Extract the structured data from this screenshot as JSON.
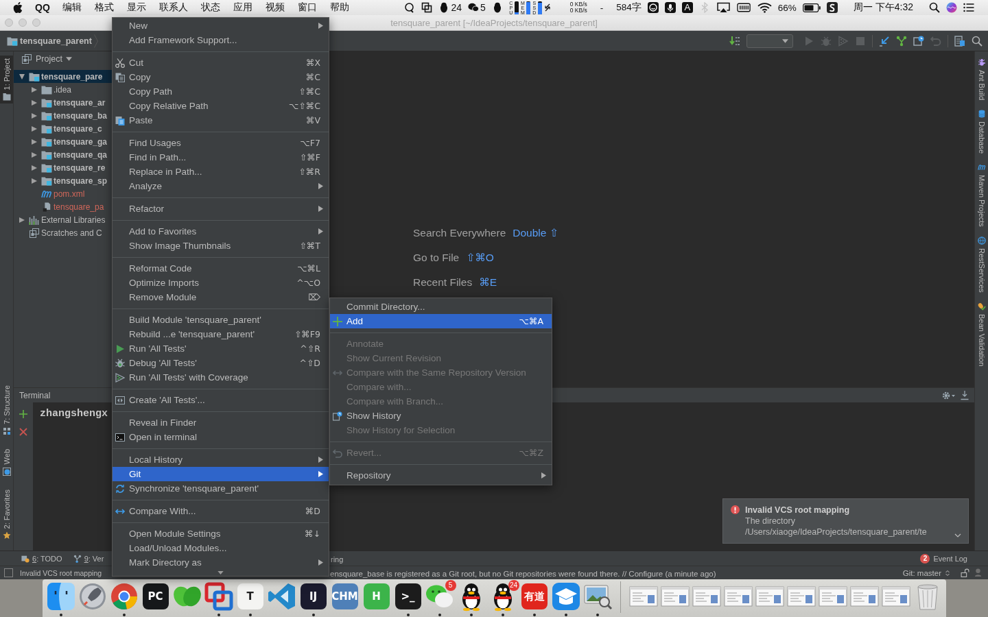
{
  "menubar": {
    "app": "QQ",
    "menus": [
      "编辑",
      "格式",
      "显示",
      "联系人",
      "状态",
      "应用",
      "视频",
      "窗口",
      "帮助"
    ],
    "qq_count": "24",
    "wechat_count": "5",
    "meters": [
      {
        "label": "CPU",
        "level": 0.15
      },
      {
        "label": "MEM",
        "level": 0.9
      },
      {
        "label": "SSD",
        "level": 0.85
      }
    ],
    "net": [
      "0 KB/s",
      "0 KB/s"
    ],
    "dash": "-",
    "word_count": "584字",
    "input_mode": "A",
    "battery": "66%",
    "clock": "周一 下午4:32"
  },
  "window": {
    "title": "tensquare_parent [~/IdeaProjects/tensquare_parent]"
  },
  "navbar": {
    "breadcrumb": "tensquare_parent"
  },
  "left_strip": {
    "top": [
      {
        "label": "1: Project",
        "selected": true
      }
    ],
    "bottom": [
      {
        "label": "7: Structure",
        "selected": false
      },
      {
        "label": "Web",
        "selected": false
      },
      {
        "label": "2: Favorites",
        "selected": false
      }
    ]
  },
  "right_strip": [
    "Ant Build",
    "Database",
    "Maven Projects",
    "RestServices",
    "Bean Validation"
  ],
  "project": {
    "title": "Project",
    "tree": [
      {
        "label": "tensquare_pare",
        "kind": "module",
        "expanded": true,
        "selected": true,
        "unversioned": false,
        "children": [
          {
            "label": ".idea",
            "kind": "folder",
            "expanded": false,
            "selected": false,
            "unversioned": false
          },
          {
            "label": "tensquare_ar",
            "kind": "module",
            "expanded": false,
            "selected": false,
            "unversioned": false
          },
          {
            "label": "tensquare_ba",
            "kind": "module",
            "expanded": false,
            "selected": false,
            "unversioned": false
          },
          {
            "label": "tensquare_c",
            "kind": "module",
            "expanded": false,
            "selected": false,
            "unversioned": false
          },
          {
            "label": "tensquare_ga",
            "kind": "module",
            "expanded": false,
            "selected": false,
            "unversioned": false
          },
          {
            "label": "tensquare_qa",
            "kind": "module",
            "expanded": false,
            "selected": false,
            "unversioned": false
          },
          {
            "label": "tensquare_re",
            "kind": "module",
            "expanded": false,
            "selected": false,
            "unversioned": false
          },
          {
            "label": "tensquare_sp",
            "kind": "module",
            "expanded": false,
            "selected": false,
            "unversioned": false
          },
          {
            "label": "pom.xml",
            "kind": "maven",
            "selected": false,
            "unversioned": true
          },
          {
            "label": "tensquare_pa",
            "kind": "file",
            "selected": false,
            "unversioned": true
          }
        ]
      },
      {
        "label": "External Libraries",
        "kind": "libraries",
        "expanded": false,
        "selected": false,
        "unversioned": false
      },
      {
        "label": "Scratches and C",
        "kind": "scratches",
        "selected": false,
        "unversioned": false
      }
    ]
  },
  "editor": {
    "hints": [
      {
        "label": "Search Everywhere",
        "shortcut": "Double ⇧"
      },
      {
        "label": "Go to File",
        "shortcut": "⇧⌘O"
      },
      {
        "label": "Recent Files",
        "shortcut": "⌘E"
      }
    ]
  },
  "terminal": {
    "title": "Terminal",
    "prompt": "zhangshengx"
  },
  "context_menu": {
    "items": [
      {
        "kind": "item",
        "label": "New",
        "submenu": true,
        "selected": false
      },
      {
        "kind": "item",
        "label": "Add Framework Support...",
        "submenu": false,
        "selected": false
      },
      {
        "kind": "separator"
      },
      {
        "kind": "item",
        "label": "Cut",
        "shortcut": "⌘X",
        "submenu": false,
        "selected": false
      },
      {
        "kind": "item",
        "label": "Copy",
        "shortcut": "⌘C",
        "submenu": false,
        "selected": false
      },
      {
        "kind": "item",
        "label": "Copy Path",
        "shortcut": "⇧⌘C",
        "submenu": false,
        "selected": false
      },
      {
        "kind": "item",
        "label": "Copy Relative Path",
        "shortcut": "⌥⇧⌘C",
        "submenu": false,
        "selected": false
      },
      {
        "kind": "item",
        "label": "Paste",
        "shortcut": "⌘V",
        "submenu": false,
        "selected": false
      },
      {
        "kind": "separator"
      },
      {
        "kind": "item",
        "label": "Find Usages",
        "shortcut": "⌥F7",
        "submenu": false,
        "selected": false
      },
      {
        "kind": "item",
        "label": "Find in Path...",
        "shortcut": "⇧⌘F",
        "submenu": false,
        "selected": false
      },
      {
        "kind": "item",
        "label": "Replace in Path...",
        "shortcut": "⇧⌘R",
        "submenu": false,
        "selected": false
      },
      {
        "kind": "item",
        "label": "Analyze",
        "submenu": true,
        "selected": false
      },
      {
        "kind": "separator"
      },
      {
        "kind": "item",
        "label": "Refactor",
        "submenu": true,
        "selected": false
      },
      {
        "kind": "separator"
      },
      {
        "kind": "item",
        "label": "Add to Favorites",
        "submenu": true,
        "selected": false
      },
      {
        "kind": "item",
        "label": "Show Image Thumbnails",
        "shortcut": "⇧⌘T",
        "submenu": false,
        "selected": false
      },
      {
        "kind": "separator"
      },
      {
        "kind": "item",
        "label": "Reformat Code",
        "shortcut": "⌥⌘L",
        "submenu": false,
        "selected": false
      },
      {
        "kind": "item",
        "label": "Optimize Imports",
        "shortcut": "^⌥O",
        "submenu": false,
        "selected": false
      },
      {
        "kind": "item",
        "label": "Remove Module",
        "shortcut": "⌦",
        "submenu": false,
        "selected": false
      },
      {
        "kind": "separator"
      },
      {
        "kind": "item",
        "label": "Build Module 'tensquare_parent'",
        "submenu": false,
        "selected": false
      },
      {
        "kind": "item",
        "label": "Rebuild ...e 'tensquare_parent'",
        "shortcut": "⇧⌘F9",
        "submenu": false,
        "selected": false
      },
      {
        "kind": "item",
        "label": "Run 'All Tests'",
        "shortcut": "^⇧R",
        "submenu": false,
        "selected": false
      },
      {
        "kind": "item",
        "label": "Debug 'All Tests'",
        "shortcut": "^⇧D",
        "submenu": false,
        "selected": false
      },
      {
        "kind": "item",
        "label": "Run 'All Tests' with Coverage",
        "submenu": false,
        "selected": false
      },
      {
        "kind": "separator"
      },
      {
        "kind": "item",
        "label": "Create 'All Tests'...",
        "submenu": false,
        "selected": false
      },
      {
        "kind": "separator"
      },
      {
        "kind": "item",
        "label": "Reveal in Finder",
        "submenu": false,
        "selected": false
      },
      {
        "kind": "item",
        "label": "Open in terminal",
        "submenu": false,
        "selected": false
      },
      {
        "kind": "separator"
      },
      {
        "kind": "item",
        "label": "Local History",
        "submenu": true,
        "selected": false
      },
      {
        "kind": "item",
        "label": "Git",
        "submenu": true,
        "selected": true
      },
      {
        "kind": "item",
        "label": "Synchronize 'tensquare_parent'",
        "submenu": false,
        "selected": false
      },
      {
        "kind": "separator"
      },
      {
        "kind": "item",
        "label": "Compare With...",
        "shortcut": "⌘D",
        "submenu": false,
        "selected": false
      },
      {
        "kind": "separator"
      },
      {
        "kind": "item",
        "label": "Open Module Settings",
        "shortcut": "⌘↓",
        "submenu": false,
        "selected": false
      },
      {
        "kind": "item",
        "label": "Load/Unload Modules...",
        "submenu": false,
        "selected": false
      },
      {
        "kind": "item",
        "label": "Mark Directory as",
        "submenu": true,
        "selected": false
      }
    ]
  },
  "git_submenu": {
    "items": [
      {
        "kind": "item",
        "label": "Commit Directory...",
        "submenu": false,
        "selected": false,
        "disabled": false
      },
      {
        "kind": "item",
        "label": "Add",
        "shortcut": "⌥⌘A",
        "submenu": false,
        "selected": true,
        "disabled": false
      },
      {
        "kind": "separator"
      },
      {
        "kind": "item",
        "label": "Annotate",
        "submenu": false,
        "selected": false,
        "disabled": true
      },
      {
        "kind": "item",
        "label": "Show Current Revision",
        "submenu": false,
        "selected": false,
        "disabled": true
      },
      {
        "kind": "item",
        "label": "Compare with the Same Repository Version",
        "submenu": false,
        "selected": false,
        "disabled": true
      },
      {
        "kind": "item",
        "label": "Compare with...",
        "submenu": false,
        "selected": false,
        "disabled": true
      },
      {
        "kind": "item",
        "label": "Compare with Branch...",
        "submenu": false,
        "selected": false,
        "disabled": true
      },
      {
        "kind": "item",
        "label": "Show History",
        "submenu": false,
        "selected": false,
        "disabled": false
      },
      {
        "kind": "item",
        "label": "Show History for Selection",
        "submenu": false,
        "selected": false,
        "disabled": true
      },
      {
        "kind": "separator"
      },
      {
        "kind": "item",
        "label": "Revert...",
        "shortcut": "⌥⌘Z",
        "submenu": false,
        "selected": false,
        "disabled": true
      },
      {
        "kind": "separator"
      },
      {
        "kind": "item",
        "label": "Repository",
        "submenu": true,
        "selected": false,
        "disabled": false
      }
    ]
  },
  "notification": {
    "title": "Invalid VCS root mapping",
    "lines": [
      "The directory",
      "/Users/xiaoge/IdeaProjects/tensquare_parent/te"
    ]
  },
  "tool_bar": {
    "tabs": [
      {
        "key": "6",
        "rest": ": TODO"
      },
      {
        "key": "9",
        "rest": ": Ver"
      }
    ],
    "partial_tab": "ring",
    "event_log": {
      "label": "Event Log",
      "badge": "2"
    }
  },
  "status_bar": {
    "message": "Invalid VCS root mapping",
    "message_continued": "ensquare_base is registered as a Git root, but no Git repositories were found there. // Configure (a minute ago)",
    "branch": "Git: master"
  },
  "dock": [
    {
      "kind": "finder",
      "running": true
    },
    {
      "kind": "rocket",
      "running": false
    },
    {
      "kind": "chrome",
      "running": true
    },
    {
      "kind": "tile",
      "glyph": "PC",
      "color": "#16181a",
      "running": false
    },
    {
      "kind": "leaves",
      "running": false
    },
    {
      "kind": "squares",
      "running": true
    },
    {
      "kind": "tile",
      "glyph": "T",
      "color": "#f4f4f2",
      "running": true
    },
    {
      "kind": "ribbon",
      "running": false
    },
    {
      "kind": "tile",
      "glyph": "IJ",
      "color": "#1b1b2e",
      "running": true
    },
    {
      "kind": "tile",
      "glyph": "CHM",
      "color": "#4f80b8",
      "running": false
    },
    {
      "kind": "tile",
      "glyph": "H",
      "color": "#3cb44a",
      "running": false
    },
    {
      "kind": "tile",
      "glyph": ">_",
      "color": "#1c1c1c",
      "running": true
    },
    {
      "kind": "chat",
      "badge": "5",
      "running": true
    },
    {
      "kind": "penguin",
      "running": true
    },
    {
      "kind": "penguin",
      "badge": "24",
      "running": true
    },
    {
      "kind": "tile",
      "glyph": "有道",
      "color": "#e0261d",
      "running": true
    },
    {
      "kind": "cap",
      "running": true
    },
    {
      "kind": "photo",
      "running": true
    },
    {
      "kind": "separator"
    },
    {
      "kind": "window"
    },
    {
      "kind": "window"
    },
    {
      "kind": "window"
    },
    {
      "kind": "window"
    },
    {
      "kind": "window"
    },
    {
      "kind": "window"
    },
    {
      "kind": "window"
    },
    {
      "kind": "window"
    },
    {
      "kind": "window"
    },
    {
      "kind": "trash"
    }
  ]
}
